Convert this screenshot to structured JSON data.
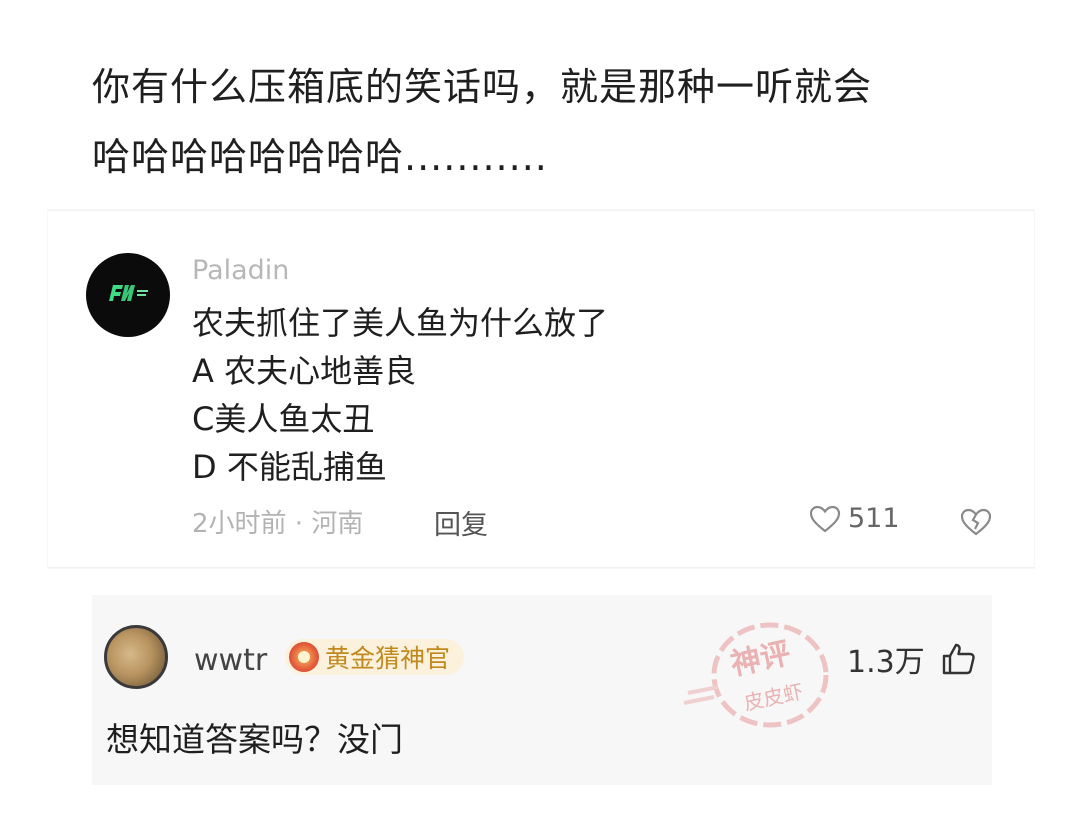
{
  "question": {
    "line1": "你有什么压箱底的笑话吗，就是那种一听就会",
    "line2": "哈哈哈哈哈哈哈哈..........."
  },
  "comment1": {
    "avatar_icon": "brand-logo-avatar",
    "username": "Paladin",
    "lines": [
      "农夫抓住了美人鱼为什么放了",
      "A 农夫心地善良",
      "C美人鱼太丑",
      "D 不能乱捕鱼"
    ],
    "meta": "2小时前 · 河南",
    "reply_label": "回复",
    "like_count": "511",
    "icons": [
      "heart-outline-icon",
      "broken-heart-icon"
    ]
  },
  "comment2": {
    "username": "wwtr",
    "badge_label": "黄金猜神官",
    "like_count": "1.3万",
    "text": "想知道答案吗？没门",
    "icons": [
      "thumbs-up-icon",
      "badge-medal-icon"
    ]
  },
  "watermark": {
    "line1": "神评",
    "line2": "皮皮虾"
  },
  "colors": {
    "text_primary": "#1f1f1f",
    "text_muted": "#b3b3b3",
    "badge_text": "#c08a1e",
    "badge_bg": "#fbf1dc",
    "watermark": "#e8a0a0",
    "card2_bg": "#f7f7f7"
  }
}
